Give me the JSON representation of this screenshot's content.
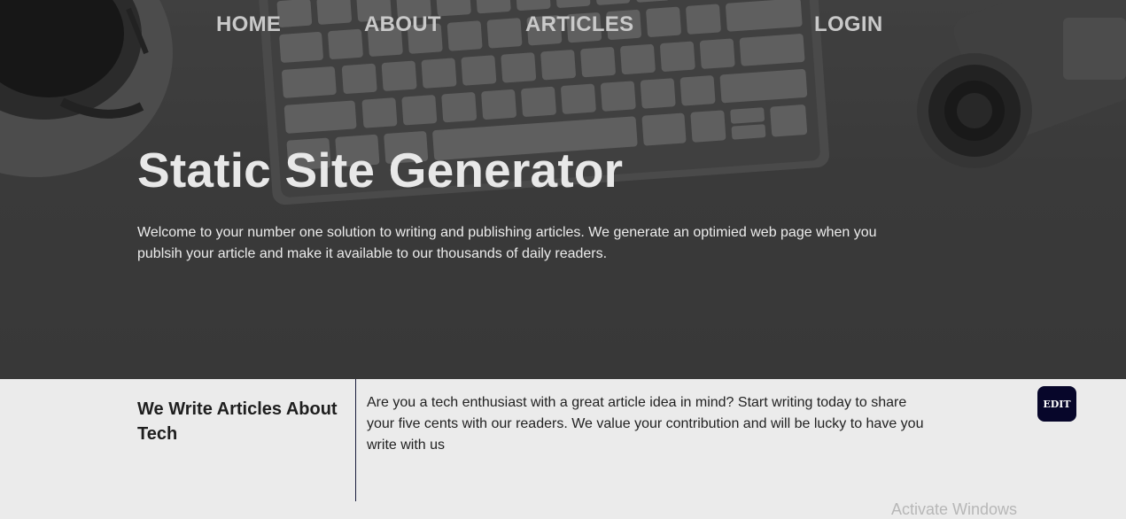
{
  "nav": {
    "home": "HOME",
    "about": "ABOUT",
    "articles": "ARTICLES",
    "login": "LOGIN"
  },
  "hero": {
    "title": "Static Site Generator",
    "description": "Welcome to your number one solution to writing and publishing articles. We generate an optimied web page when you publsih your article and make it available to our thousands of daily readers."
  },
  "info": {
    "heading": "We Write Articles About Tech",
    "text": "Are you a tech enthusiast with a great article idea in mind? Start writing today to share your five cents with our readers. We value your contribution and will be lucky to have you write with us",
    "edit_label": "EDIT"
  },
  "system": {
    "watermark": "Activate Windows"
  },
  "colors": {
    "nav_text": "#c9c9c9",
    "hero_overlay": "#414141",
    "section_bg": "#ebebeb",
    "edit_button": "#07062a",
    "divider": "#1a1d3d"
  }
}
